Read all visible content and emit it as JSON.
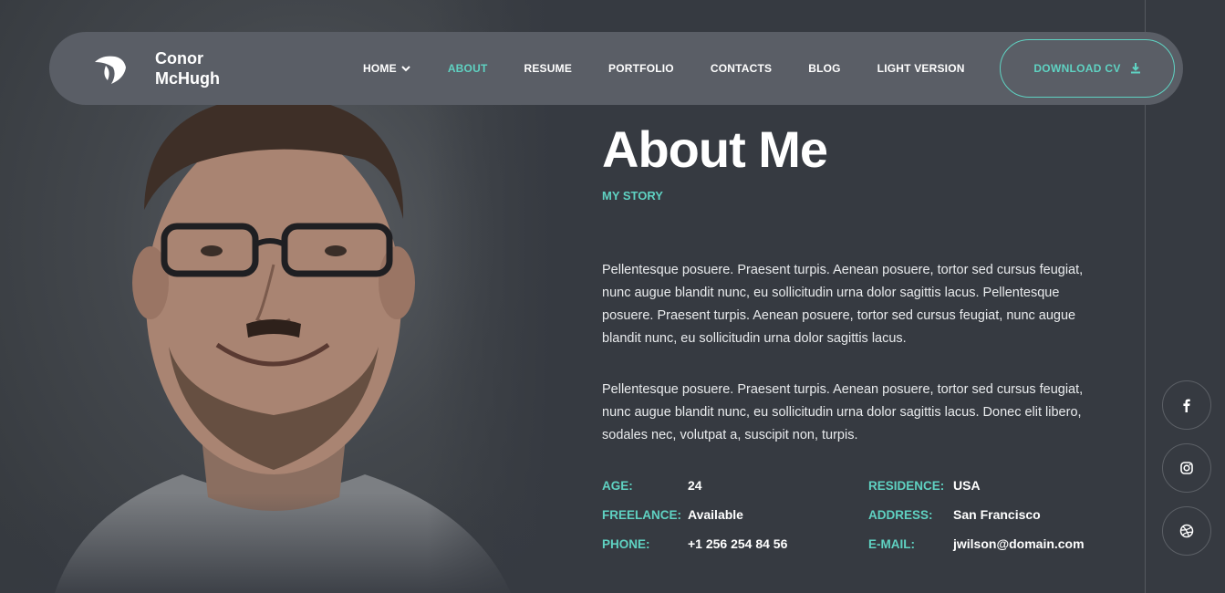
{
  "header": {
    "brand_line1": "Conor",
    "brand_line2": "McHugh",
    "nav": [
      {
        "label": "HOME",
        "has_dropdown": true,
        "active": false
      },
      {
        "label": "ABOUT",
        "active": true
      },
      {
        "label": "RESUME",
        "active": false
      },
      {
        "label": "PORTFOLIO",
        "active": false
      },
      {
        "label": "CONTACTS",
        "active": false
      },
      {
        "label": "BLOG",
        "active": false
      },
      {
        "label": "LIGHT VERSION",
        "active": false
      }
    ],
    "cv_button": "DOWNLOAD CV",
    "cv_icon": "download-icon"
  },
  "colors": {
    "accent": "#5fd2c2",
    "background": "#363a41",
    "header_bg": "#5a5e66"
  },
  "about": {
    "title": "About Me",
    "subtitle": "MY STORY",
    "paragraph1": "Pellentesque posuere. Praesent turpis. Aenean posuere, tortor sed cursus feugiat, nunc augue blandit nunc, eu sollicitudin urna dolor sagittis lacus. Pellentesque posuere. Praesent turpis. Aenean posuere, tortor sed cursus feugiat, nunc augue blandit nunc, eu sollicitudin urna dolor sagittis lacus.",
    "paragraph2": "Pellentesque posuere. Praesent turpis. Aenean posuere, tortor sed cursus feugiat, nunc augue blandit nunc, eu sollicitudin urna dolor sagittis lacus. Donec elit libero, sodales nec, volutpat a, suscipit non, turpis."
  },
  "info": {
    "age_label": "AGE:",
    "age_value": "24",
    "freelance_label": "FREELANCE:",
    "freelance_value": "Available",
    "phone_label": "PHONE:",
    "phone_value": "+1 256 254 84 56",
    "residence_label": "RESIDENCE:",
    "residence_value": "USA",
    "address_label": "ADDRESS:",
    "address_value": "San Francisco",
    "email_label": "E-MAIL:",
    "email_value": "jwilson@domain.com"
  },
  "social": [
    "facebook-icon",
    "instagram-icon",
    "dribbble-icon"
  ]
}
